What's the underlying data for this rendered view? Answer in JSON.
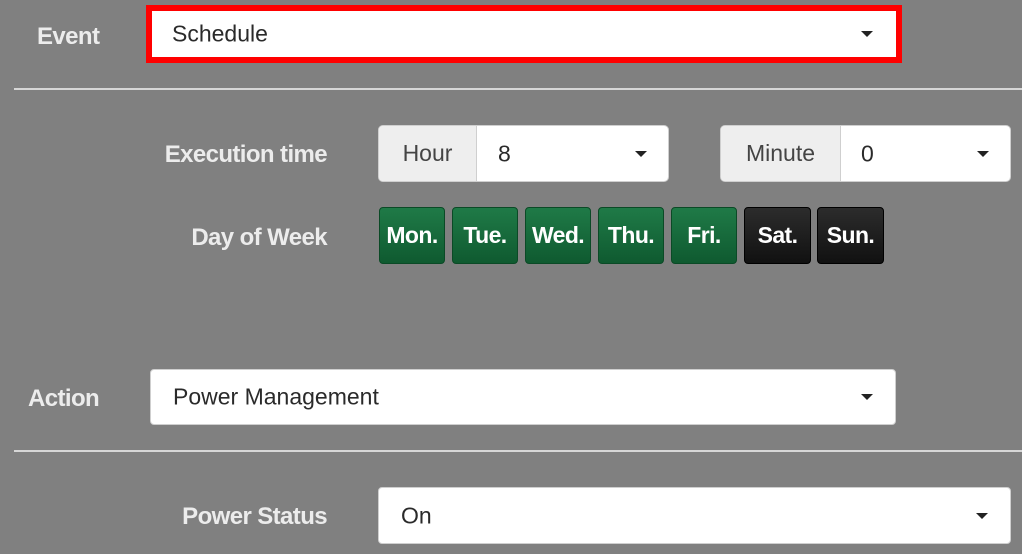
{
  "event": {
    "label": "Event",
    "value": "Schedule"
  },
  "execution_time": {
    "label": "Execution time",
    "hour": {
      "label": "Hour",
      "value": "8"
    },
    "minute": {
      "label": "Minute",
      "value": "0"
    }
  },
  "day_of_week": {
    "label": "Day of Week",
    "days": [
      {
        "label": "Mon.",
        "selected": true
      },
      {
        "label": "Tue.",
        "selected": true
      },
      {
        "label": "Wed.",
        "selected": true
      },
      {
        "label": "Thu.",
        "selected": true
      },
      {
        "label": "Fri.",
        "selected": true
      },
      {
        "label": "Sat.",
        "selected": false
      },
      {
        "label": "Sun.",
        "selected": false
      }
    ]
  },
  "action": {
    "label": "Action",
    "value": "Power Management"
  },
  "power_status": {
    "label": "Power Status",
    "value": "On"
  },
  "colors": {
    "background": "#808080",
    "highlight": "#ff0000",
    "day_selected": "#176b3c",
    "day_unselected": "#1a1a1a"
  },
  "icons": {
    "dropdown": "chevron-down-icon"
  }
}
